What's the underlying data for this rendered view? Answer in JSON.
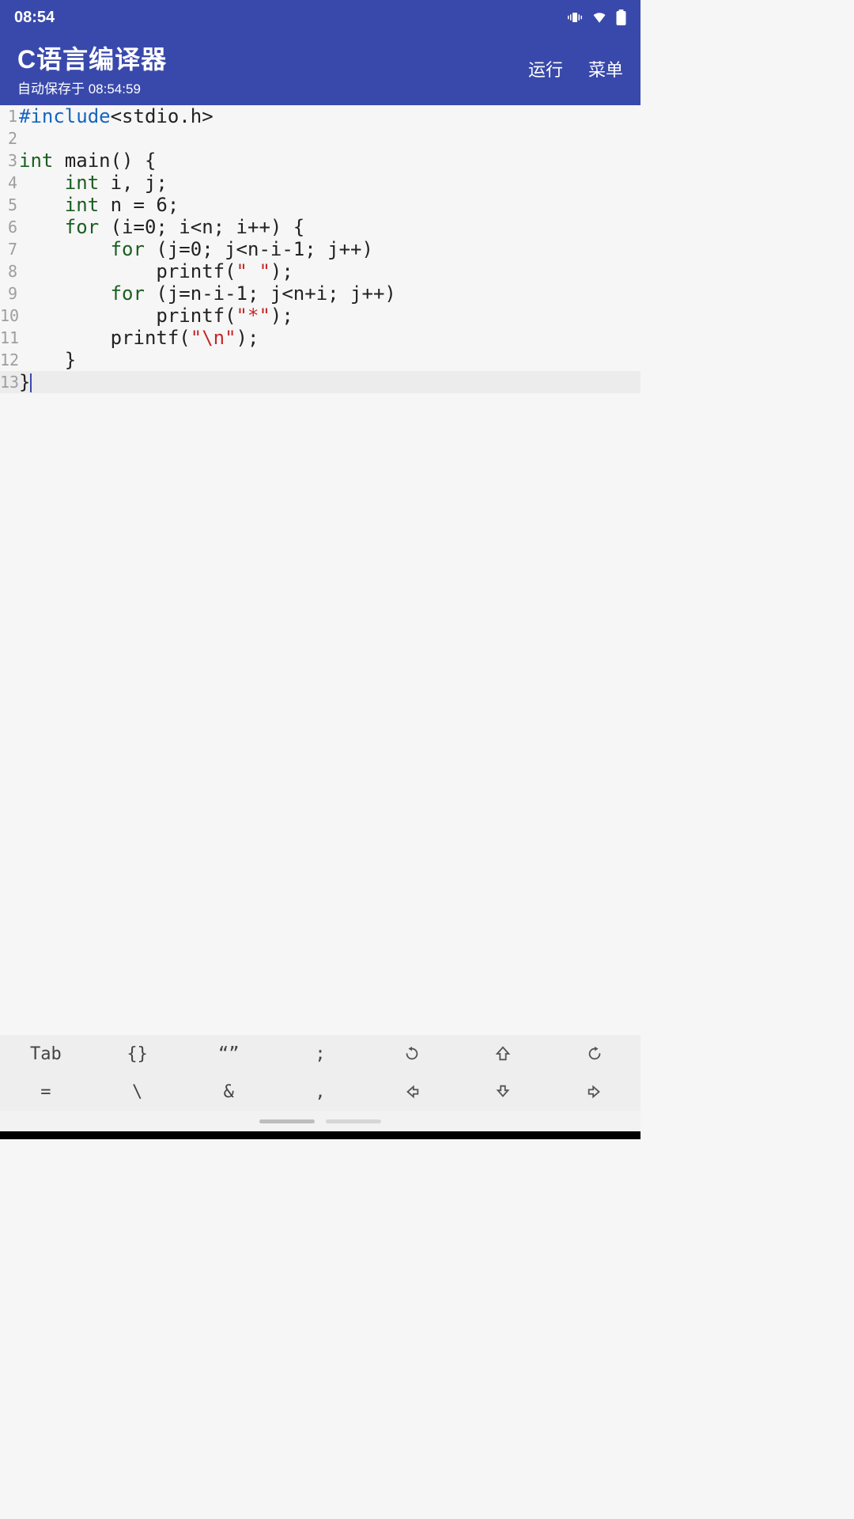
{
  "status": {
    "time": "08:54"
  },
  "header": {
    "title": "C语言编译器",
    "subtitle": "自动保存于 08:54:59",
    "run": "运行",
    "menu": "菜单"
  },
  "colors": {
    "primary": "#3949ab"
  },
  "code": {
    "cursor_line": 13,
    "lines": [
      {
        "n": "1",
        "tokens": [
          {
            "t": "#include",
            "c": "tok-pp"
          },
          {
            "t": "<stdio.h>",
            "c": ""
          }
        ]
      },
      {
        "n": "2",
        "tokens": []
      },
      {
        "n": "3",
        "tokens": [
          {
            "t": "int",
            "c": "tok-kw"
          },
          {
            "t": " main() {",
            "c": ""
          }
        ]
      },
      {
        "n": "4",
        "tokens": [
          {
            "t": "    ",
            "c": ""
          },
          {
            "t": "int",
            "c": "tok-kw"
          },
          {
            "t": " i, j;",
            "c": ""
          }
        ]
      },
      {
        "n": "5",
        "tokens": [
          {
            "t": "    ",
            "c": ""
          },
          {
            "t": "int",
            "c": "tok-kw"
          },
          {
            "t": " n = 6;",
            "c": ""
          }
        ]
      },
      {
        "n": "6",
        "tokens": [
          {
            "t": "    ",
            "c": ""
          },
          {
            "t": "for",
            "c": "tok-kw"
          },
          {
            "t": " (i=0; i<n; i++) {",
            "c": ""
          }
        ]
      },
      {
        "n": "7",
        "tokens": [
          {
            "t": "        ",
            "c": ""
          },
          {
            "t": "for",
            "c": "tok-kw"
          },
          {
            "t": " (j=0; j<n-i-1; j++)",
            "c": ""
          }
        ]
      },
      {
        "n": "8",
        "tokens": [
          {
            "t": "            printf(",
            "c": ""
          },
          {
            "t": "\" \"",
            "c": "tok-str"
          },
          {
            "t": ");",
            "c": ""
          }
        ]
      },
      {
        "n": "9",
        "tokens": [
          {
            "t": "        ",
            "c": ""
          },
          {
            "t": "for",
            "c": "tok-kw"
          },
          {
            "t": " (j=n-i-1; j<n+i; j++)",
            "c": ""
          }
        ]
      },
      {
        "n": "10",
        "tokens": [
          {
            "t": "            printf(",
            "c": ""
          },
          {
            "t": "\"*\"",
            "c": "tok-str"
          },
          {
            "t": ");",
            "c": ""
          }
        ]
      },
      {
        "n": "11",
        "tokens": [
          {
            "t": "        printf(",
            "c": ""
          },
          {
            "t": "\"\\n\"",
            "c": "tok-str"
          },
          {
            "t": ");",
            "c": ""
          }
        ]
      },
      {
        "n": "12",
        "tokens": [
          {
            "t": "    }",
            "c": ""
          }
        ]
      },
      {
        "n": "13",
        "tokens": [
          {
            "t": "}",
            "c": ""
          }
        ]
      }
    ]
  },
  "toolbar": {
    "row1": [
      "Tab",
      "{}",
      "“”",
      ";",
      "undo-icon",
      "shift-up-icon",
      "redo-icon"
    ],
    "row2": [
      "=",
      "\\",
      "&",
      ",",
      "arrow-left-icon",
      "arrow-down-icon",
      "arrow-right-icon"
    ]
  }
}
